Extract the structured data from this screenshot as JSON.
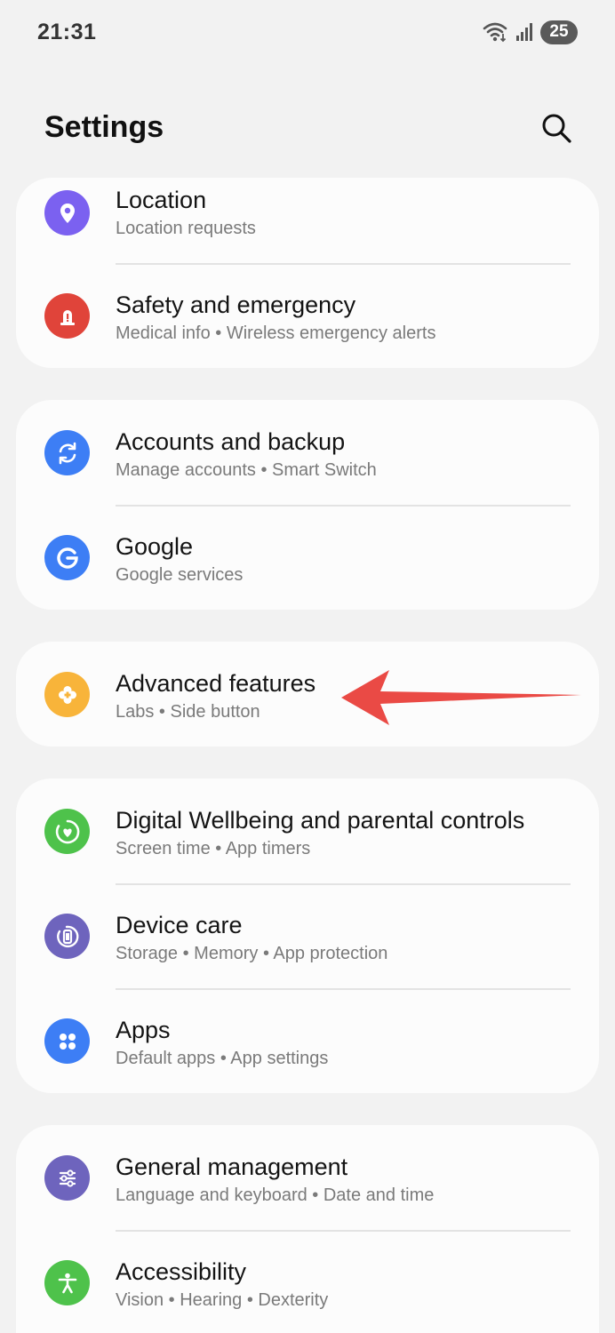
{
  "status_bar": {
    "time": "21:31",
    "battery": "25",
    "icons": [
      "wifi-icon",
      "signal-icon",
      "battery-icon"
    ]
  },
  "header": {
    "title": "Settings",
    "search_icon": "search-icon"
  },
  "groups": [
    {
      "items": [
        {
          "title": "Location",
          "subtitle": "Location requests",
          "icon": "location-pin-icon",
          "color": "#7b61f0"
        },
        {
          "title": "Safety and emergency",
          "subtitle": "Medical info  •  Wireless emergency alerts",
          "icon": "emergency-siren-icon",
          "color": "#e0443a"
        }
      ]
    },
    {
      "items": [
        {
          "title": "Accounts and backup",
          "subtitle": "Manage accounts  •  Smart Switch",
          "icon": "sync-icon",
          "color": "#3d7ef5"
        },
        {
          "title": "Google",
          "subtitle": "Google services",
          "icon": "google-icon",
          "color": "#3d7ef5"
        }
      ]
    },
    {
      "items": [
        {
          "title": "Advanced features",
          "subtitle": "Labs  •  Side button",
          "icon": "advanced-features-icon",
          "color": "#f8b43a"
        }
      ]
    },
    {
      "items": [
        {
          "title": "Digital Wellbeing and parental controls",
          "subtitle": "Screen time  •  App timers",
          "icon": "wellbeing-icon",
          "color": "#4ec24b"
        },
        {
          "title": "Device care",
          "subtitle": "Storage  •  Memory  •  App protection",
          "icon": "device-care-icon",
          "color": "#6e64bd"
        },
        {
          "title": "Apps",
          "subtitle": "Default apps  •  App settings",
          "icon": "apps-grid-icon",
          "color": "#3d7ef5"
        }
      ]
    },
    {
      "items": [
        {
          "title": "General management",
          "subtitle": "Language and keyboard  •  Date and time",
          "icon": "sliders-icon",
          "color": "#6e64bd"
        },
        {
          "title": "Accessibility",
          "subtitle": "Vision  •  Hearing  •  Dexterity",
          "icon": "accessibility-icon",
          "color": "#4ec24b"
        }
      ]
    }
  ],
  "annotation": {
    "arrow_color": "#ea4a45",
    "points_to": "Advanced features"
  }
}
